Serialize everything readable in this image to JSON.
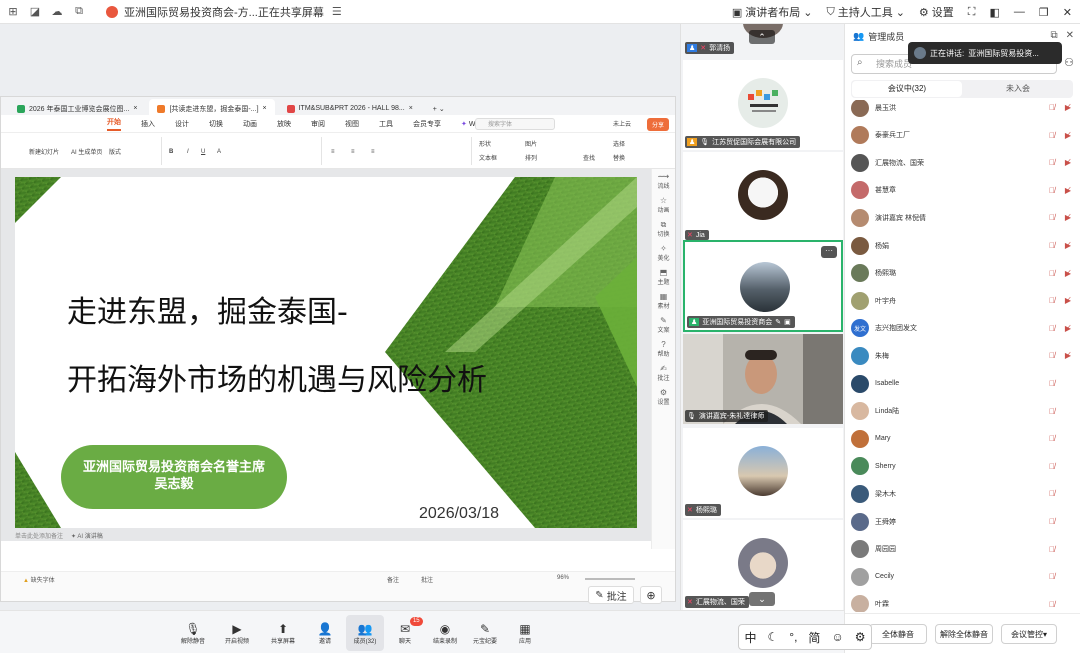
{
  "titlebar": {
    "window_title": "亚洲国际贸易投资商会-方...正在共享屏幕",
    "presenter_layout": "演讲者布局",
    "host_tools": "主持人工具",
    "settings": "设置"
  },
  "wps": {
    "tabs": [
      {
        "label": "2026 年泰国工业博览会展位图..."
      },
      {
        "label": "[共读走进东盟，掘金泰国-...]"
      },
      {
        "label": "ITM&SUB&PRT 2026 - HALL 98..."
      }
    ],
    "menu": [
      "开始",
      "插入",
      "设计",
      "切换",
      "动画",
      "放映",
      "审阅",
      "视图",
      "工具",
      "会员专享"
    ],
    "wps_ai": "WPS AI",
    "search_placeholder": "搜索字体",
    "upload": "未上云",
    "share": "分享",
    "toolbar": {
      "new_slide": "新建幻灯片",
      "ai_slide": "AI 生成单页",
      "layout": "版式",
      "shape": "形状",
      "image": "图片",
      "textbox": "文本框",
      "arrange": "排列",
      "find": "查找",
      "select": "选择",
      "replace": "替换"
    },
    "side_tools": [
      "流线",
      "动画",
      "切换",
      "美化",
      "主题",
      "素材",
      "文案",
      "帮助",
      "批注",
      "设置"
    ],
    "status": {
      "notes_hint": "单击此处添加备注",
      "ai_speech": "AI 演讲稿",
      "missing_font": "缺失字体",
      "notes": "备注",
      "annotation": "批注",
      "zoom": "96%"
    },
    "annotation_button": "批注"
  },
  "slide": {
    "title_line1": "走进东盟，掘金泰国-",
    "title_line2": "开拓海外市场的机遇与风险分析",
    "badge_line1": "亚洲国际贸易投资商会名誉主席",
    "badge_line2": "吴志毅",
    "date": "2026/03/18"
  },
  "video_tiles": [
    {
      "name": "郭清扬"
    },
    {
      "name": "江苏贸促国际会展有限公司"
    },
    {
      "name": "Jia"
    },
    {
      "name": "亚洲国际贸易投资商会"
    },
    {
      "name": "演讲嘉宾-朱礼達律师"
    },
    {
      "name": "杨熙璐"
    },
    {
      "name": "汇展物流、国荣"
    }
  ],
  "toast": {
    "prefix": "正在讲话:",
    "speaker": "亚洲国际贸易投资..."
  },
  "members": {
    "header": "管理成员",
    "search_placeholder": "搜索成员",
    "tab_in_meeting": "会议中(32)",
    "tab_not_joined": "未入会",
    "list": [
      {
        "name": "晨玉洪",
        "color": "#8a6a55"
      },
      {
        "name": "泰豪兵工厂",
        "color": "#b07a5a"
      },
      {
        "name": "汇展物流、国荣",
        "color": "#555555"
      },
      {
        "name": "甚慧章",
        "color": "#c46a6a"
      },
      {
        "name": "演讲嘉宾 林倪倩",
        "color": "#b58b70"
      },
      {
        "name": "杨娟",
        "color": "#7a5a40"
      },
      {
        "name": "杨熙璐",
        "color": "#6a7a5a"
      },
      {
        "name": "叶宇舟",
        "color": "#a0a070"
      },
      {
        "name": "志兴抱团发文",
        "color": "#2f6fd0",
        "initials": "发文"
      },
      {
        "name": "朱梅",
        "color": "#3a8ac0"
      },
      {
        "name": "Isabelle",
        "color": "#2a4a6a"
      },
      {
        "name": "Linda陆",
        "color": "#d8b8a0"
      },
      {
        "name": "Mary",
        "color": "#c0703a"
      },
      {
        "name": "Sherry",
        "color": "#4a8a5a"
      },
      {
        "name": "梁木木",
        "color": "#3a5a7a"
      },
      {
        "name": "王舜婷",
        "color": "#5a6a8a"
      },
      {
        "name": "周园园",
        "color": "#7a7a7a"
      },
      {
        "name": "Cecily",
        "color": "#a0a0a0"
      },
      {
        "name": "叶霖",
        "color": "#c8b0a0"
      }
    ],
    "mute_all": "全体静音",
    "unmute_all": "解除全体静音",
    "meeting_control": "会议管控"
  },
  "meeting_bar": {
    "items": [
      {
        "label": "解除静音",
        "icon": "mic-off-icon"
      },
      {
        "label": "开启视频",
        "icon": "camera-off-icon"
      },
      {
        "label": "共享屏幕",
        "icon": "share-screen-icon"
      },
      {
        "label": "邀请",
        "icon": "invite-icon"
      },
      {
        "label": "成员(32)",
        "icon": "members-icon"
      },
      {
        "label": "聊天",
        "icon": "chat-icon",
        "badge": "15"
      },
      {
        "label": "结束录制",
        "icon": "record-icon"
      },
      {
        "label": "元宝纪要",
        "icon": "notes-icon"
      },
      {
        "label": "应用",
        "icon": "apps-icon"
      }
    ]
  },
  "ime": {
    "mode": "中",
    "punct": "°,",
    "simplified": "简"
  }
}
